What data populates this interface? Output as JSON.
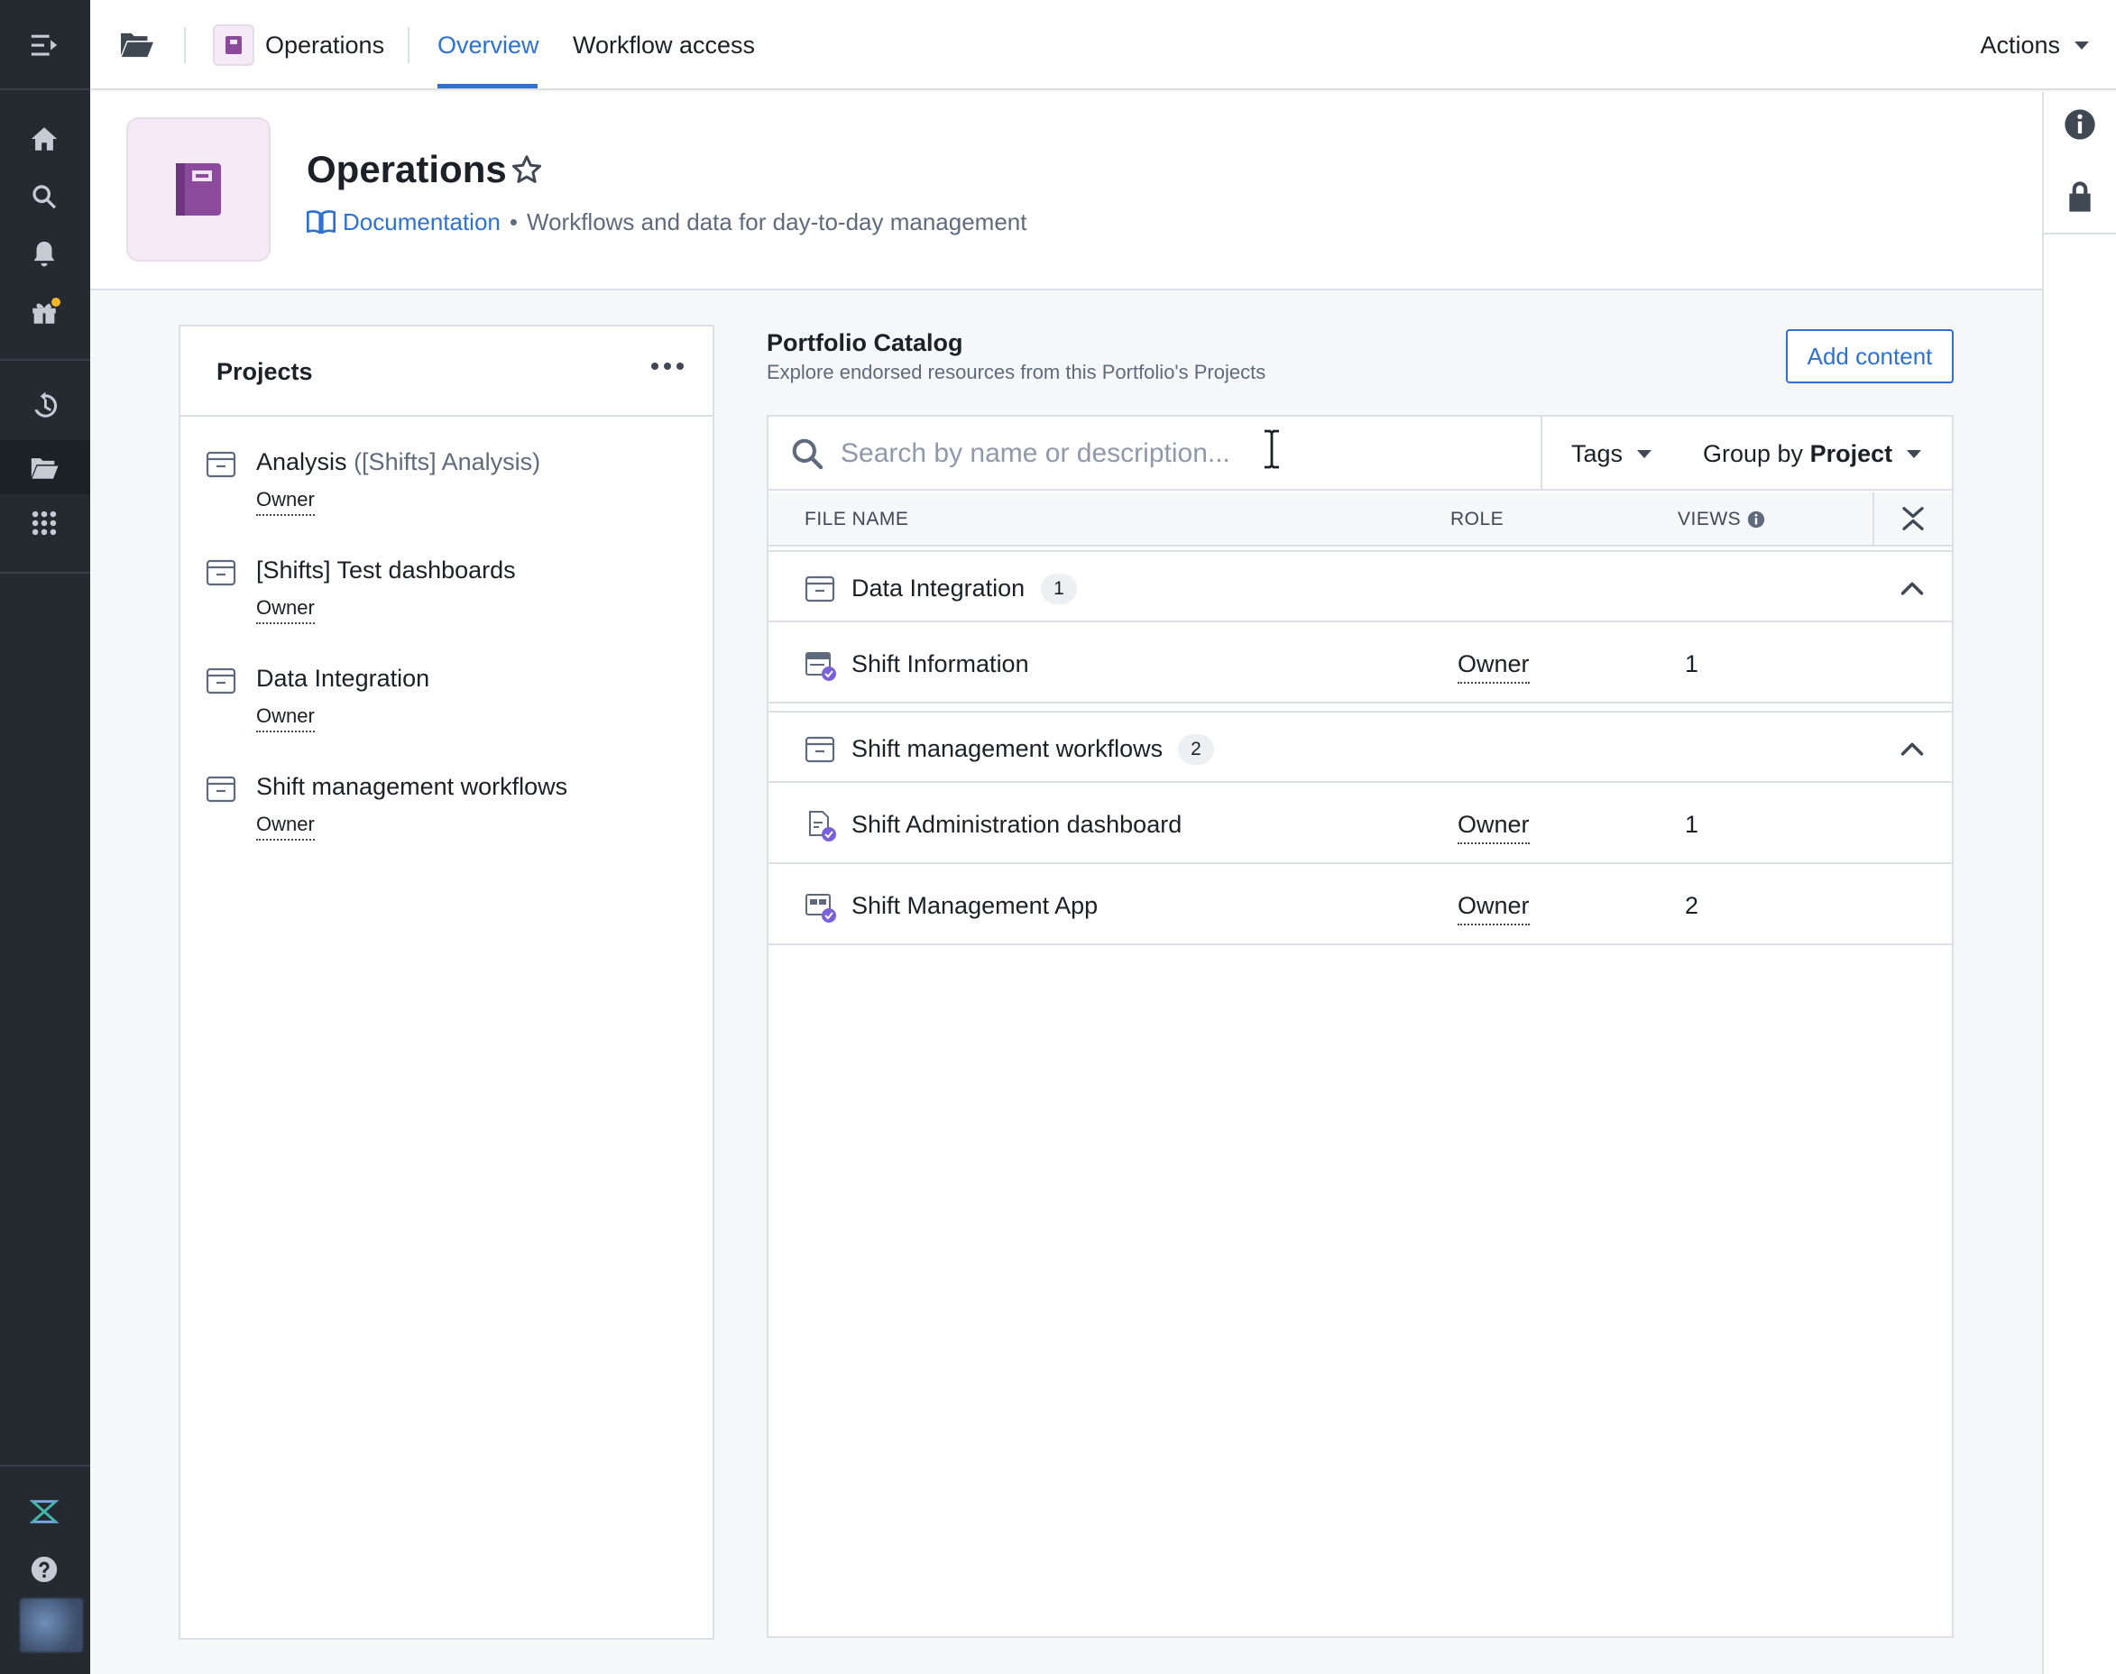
{
  "topbar": {
    "app_name": "Operations",
    "tabs": [
      {
        "label": "Overview",
        "active": true
      },
      {
        "label": "Workflow access",
        "active": false
      }
    ],
    "actions_label": "Actions"
  },
  "header": {
    "title": "Operations",
    "doc_link": "Documentation",
    "separator": "•",
    "description": "Workflows and data for day-to-day management"
  },
  "projects": {
    "title": "Projects",
    "items": [
      {
        "name": "Analysis",
        "alias": "([Shifts] Analysis)",
        "role": "Owner"
      },
      {
        "name": "[Shifts] Test dashboards",
        "alias": "",
        "role": "Owner"
      },
      {
        "name": "Data Integration",
        "alias": "",
        "role": "Owner"
      },
      {
        "name": "Shift management workflows",
        "alias": "",
        "role": "Owner"
      }
    ]
  },
  "catalog": {
    "title": "Portfolio Catalog",
    "subtitle": "Explore endorsed resources from this Portfolio's Projects",
    "add_button": "Add content",
    "search_placeholder": "Search by name or description...",
    "tags_label": "Tags",
    "group_by_prefix": "Group by",
    "group_by_value": "Project",
    "columns": {
      "file_name": "FILE NAME",
      "role": "ROLE",
      "views": "VIEWS"
    },
    "groups": [
      {
        "name": "Data Integration",
        "count": "1",
        "rows": [
          {
            "name": "Shift Information",
            "role": "Owner",
            "views": "1",
            "icon": "dataset-icon"
          }
        ]
      },
      {
        "name": "Shift management workflows",
        "count": "2",
        "rows": [
          {
            "name": "Shift Administration dashboard",
            "role": "Owner",
            "views": "1",
            "icon": "dashboard-icon"
          },
          {
            "name": "Shift Management App",
            "role": "Owner",
            "views": "2",
            "icon": "app-icon"
          }
        ]
      }
    ]
  },
  "colors": {
    "accent": "#2d72d2",
    "rail": "#252a31",
    "portfolio_purple": "#8b4a9b",
    "notification_dot": "#f0b726"
  }
}
